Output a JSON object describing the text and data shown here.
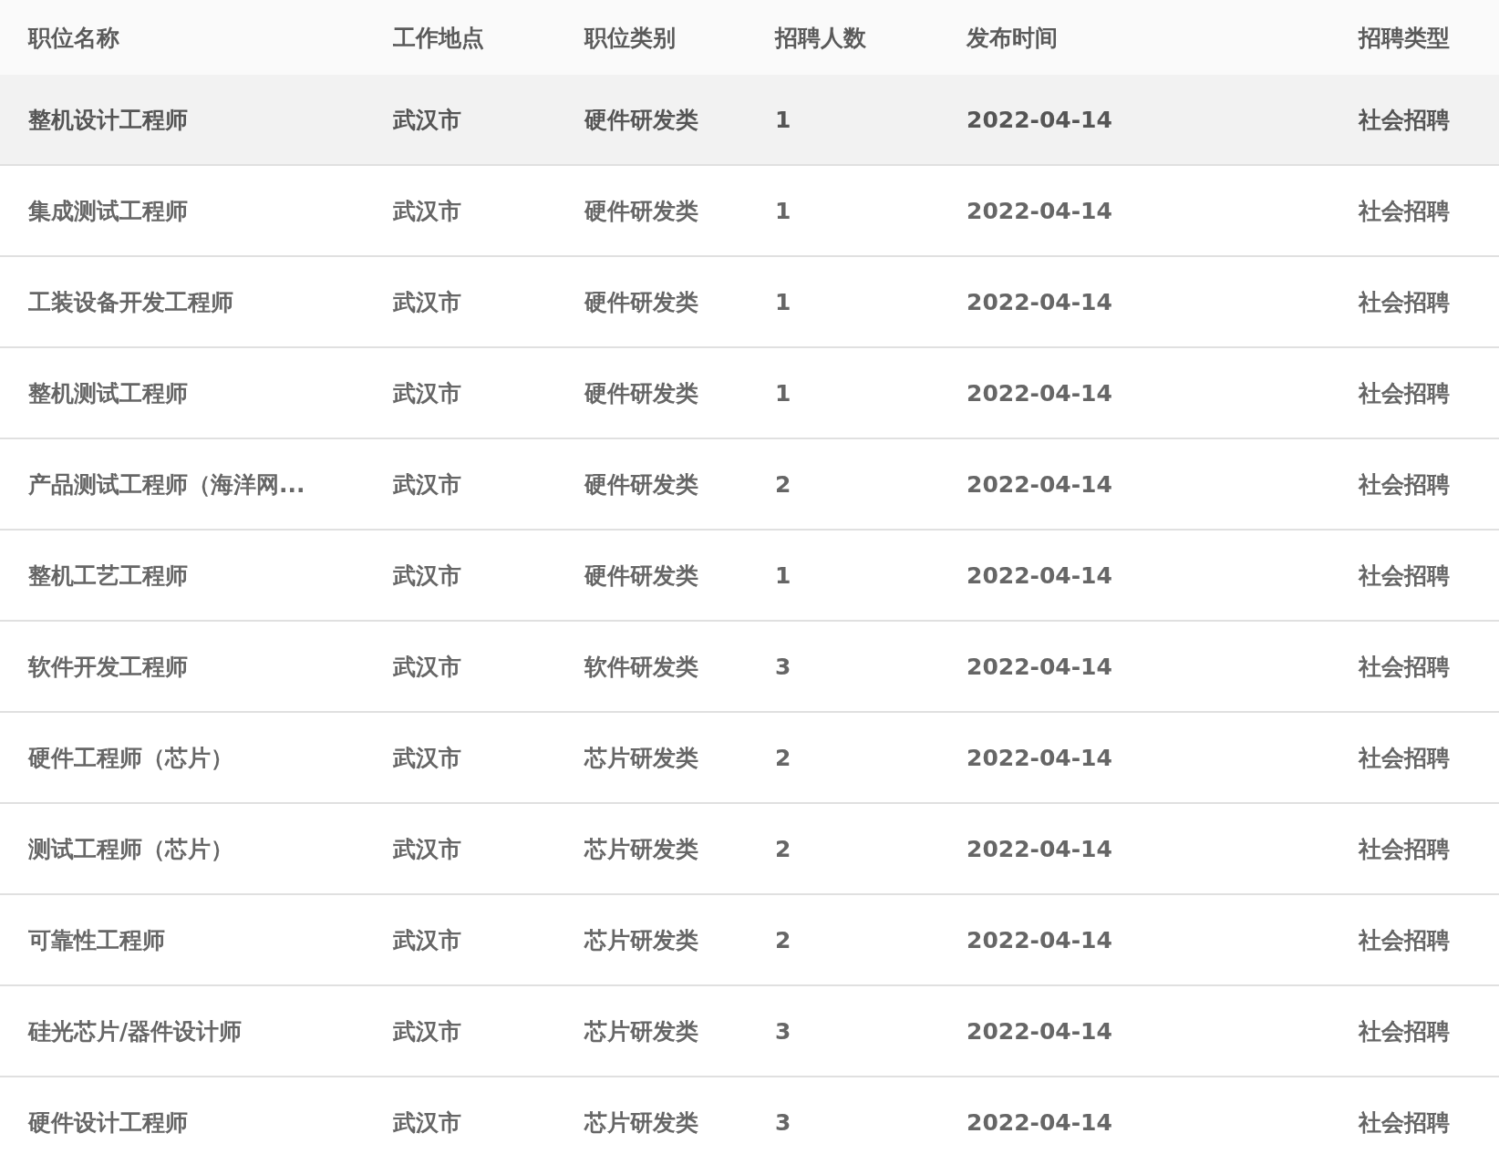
{
  "table": {
    "columns": [
      "职位名称",
      "工作地点",
      "职位类别",
      "招聘人数",
      "发布时间",
      "招聘类型"
    ],
    "rows": [
      {
        "cells": [
          "整机设计工程师",
          "武汉市",
          "硬件研发类",
          "1",
          "2022-04-14",
          "社会招聘"
        ],
        "highlighted": true
      },
      {
        "cells": [
          "集成测试工程师",
          "武汉市",
          "硬件研发类",
          "1",
          "2022-04-14",
          "社会招聘"
        ],
        "highlighted": false
      },
      {
        "cells": [
          "工装设备开发工程师",
          "武汉市",
          "硬件研发类",
          "1",
          "2022-04-14",
          "社会招聘"
        ],
        "highlighted": false
      },
      {
        "cells": [
          "整机测试工程师",
          "武汉市",
          "硬件研发类",
          "1",
          "2022-04-14",
          "社会招聘"
        ],
        "highlighted": false
      },
      {
        "cells": [
          "产品测试工程师（海洋网...",
          "武汉市",
          "硬件研发类",
          "2",
          "2022-04-14",
          "社会招聘"
        ],
        "highlighted": false
      },
      {
        "cells": [
          "整机工艺工程师",
          "武汉市",
          "硬件研发类",
          "1",
          "2022-04-14",
          "社会招聘"
        ],
        "highlighted": false
      },
      {
        "cells": [
          "软件开发工程师",
          "武汉市",
          "软件研发类",
          "3",
          "2022-04-14",
          "社会招聘"
        ],
        "highlighted": false
      },
      {
        "cells": [
          "硬件工程师（芯片）",
          "武汉市",
          "芯片研发类",
          "2",
          "2022-04-14",
          "社会招聘"
        ],
        "highlighted": false
      },
      {
        "cells": [
          "测试工程师（芯片）",
          "武汉市",
          "芯片研发类",
          "2",
          "2022-04-14",
          "社会招聘"
        ],
        "highlighted": false
      },
      {
        "cells": [
          "可靠性工程师",
          "武汉市",
          "芯片研发类",
          "2",
          "2022-04-14",
          "社会招聘"
        ],
        "highlighted": false
      },
      {
        "cells": [
          "硅光芯片/器件设计师",
          "武汉市",
          "芯片研发类",
          "3",
          "2022-04-14",
          "社会招聘"
        ],
        "highlighted": false
      },
      {
        "cells": [
          "硬件设计工程师",
          "武汉市",
          "芯片研发类",
          "3",
          "2022-04-14",
          "社会招聘"
        ],
        "highlighted": false
      }
    ]
  }
}
